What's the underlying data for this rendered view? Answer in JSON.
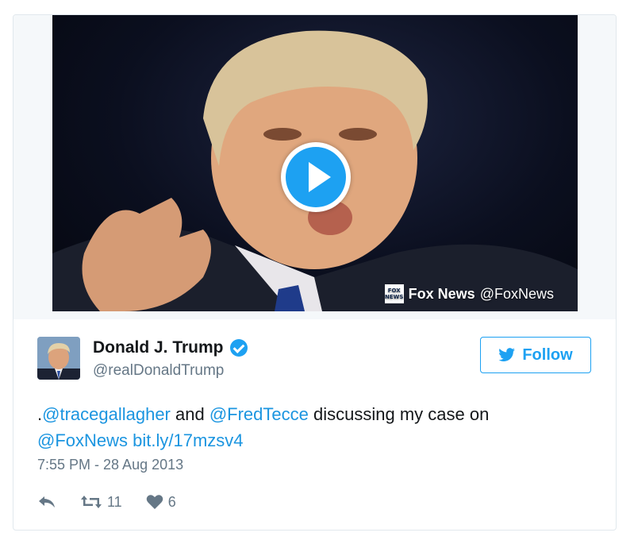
{
  "media": {
    "attribution_source": "Fox News",
    "attribution_handle": "@FoxNews",
    "logo_text_1": "FOX",
    "logo_text_2": "NEWS",
    "play_icon": "play-icon"
  },
  "author": {
    "name": "Donald J. Trump",
    "handle": "@realDonaldTrump",
    "verified": true
  },
  "follow_label": "Follow",
  "tweet": {
    "prefix": ".",
    "mention1": "@tracegallagher",
    "and": " and ",
    "mention2": "@FredTecce",
    "middle": " discussing my case on ",
    "mention3": "@FoxNews",
    "space": " ",
    "link": "bit.ly/17mzsv4"
  },
  "timestamp": "7:55 PM - 28 Aug 2013",
  "actions": {
    "retweet_count": "11",
    "like_count": "6"
  },
  "colors": {
    "accent": "#1da1f2",
    "link": "#1b95e0",
    "muted": "#657786"
  }
}
